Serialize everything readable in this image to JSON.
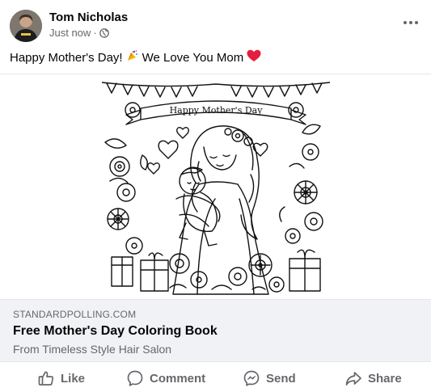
{
  "post": {
    "author": "Tom Nicholas",
    "time": "Just now",
    "separator": "·",
    "privacy_icon": "globe-icon",
    "message": "Happy Mother's Day!",
    "message_party_emoji": "🎉",
    "message_tail": "We Love You Mom",
    "message_heart_emoji": "❤️",
    "more_icon": "more-options-icon"
  },
  "media": {
    "banner_text": "Happy Mother's Day",
    "style": "black-and-white line art coloring page"
  },
  "link_preview": {
    "domain": "STANDARDPOLLING.COM",
    "title": "Free Mother's Day Coloring Book",
    "subtitle": "From Timeless Style Hair Salon"
  },
  "actions": [
    {
      "label": "Like",
      "icon": "thumbs-up-icon"
    },
    {
      "label": "Comment",
      "icon": "comment-bubble-icon"
    },
    {
      "label": "Send",
      "icon": "messenger-icon"
    },
    {
      "label": "Share",
      "icon": "share-arrow-icon"
    }
  ],
  "colors": {
    "text_primary": "#050505",
    "text_secondary": "#65676b",
    "preview_bg": "#f0f2f5",
    "divider": "#e4e6eb",
    "heart": "#e41e3f"
  }
}
